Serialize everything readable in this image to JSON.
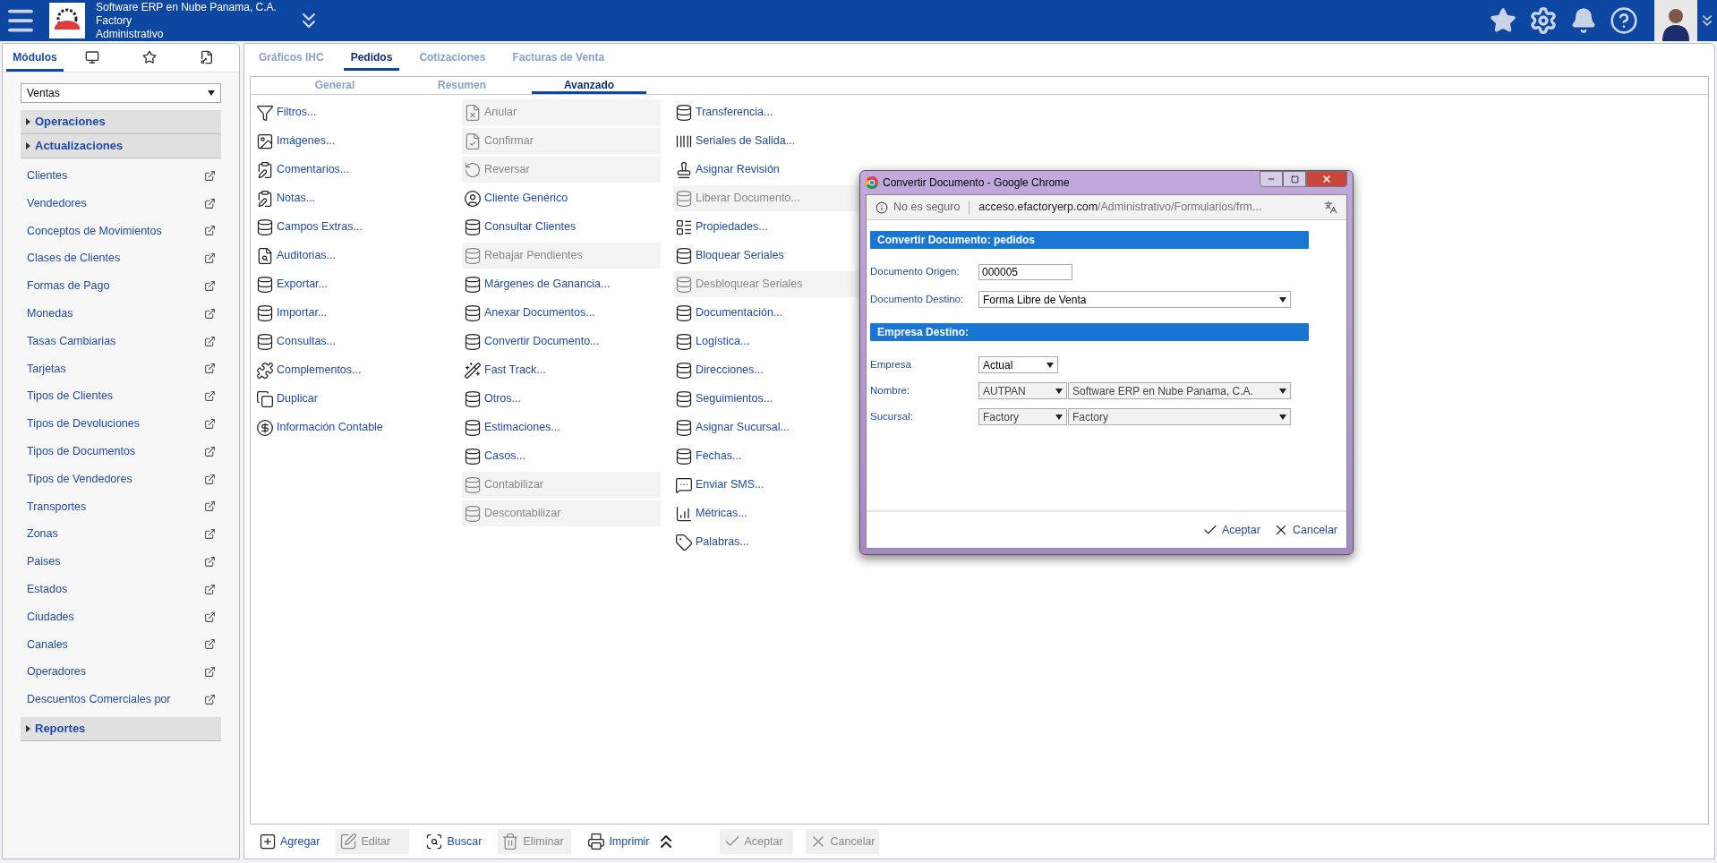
{
  "header": {
    "company": "Software ERP en Nube Panama, C.A.",
    "branch": "Factory",
    "module": "Administrativo"
  },
  "sidebar": {
    "tabs": [
      {
        "label": "Módulos",
        "selected": true
      },
      {
        "selected": false
      },
      {
        "selected": false
      },
      {
        "selected": false
      }
    ],
    "module_select": "Ventas",
    "sections": [
      {
        "title": "Operaciones"
      },
      {
        "title": "Actualizaciones",
        "items": [
          "Clientes",
          "Vendedores",
          "Conceptos de Movimientos",
          "Clases de Clientes",
          "Formas de Pago",
          "Monedas",
          "Tasas Cambiarias",
          "Tarjetas",
          "Tipos de Clientes",
          "Tipos de Devoluciones",
          "Tipos de Documentos",
          "Tipos de Vendedores",
          "Transportes",
          "Zonas",
          "Paises",
          "Estados",
          "Ciudades",
          "Canales",
          "Operadores",
          "Descuentos Comerciales por "
        ]
      },
      {
        "title": "Reportes"
      }
    ]
  },
  "tabs": [
    {
      "label": "Gráficos IHC",
      "selected": false
    },
    {
      "label": "Pedidos",
      "selected": true
    },
    {
      "label": "Cotizaciones",
      "selected": false
    },
    {
      "label": "Facturas de Venta",
      "selected": false
    }
  ],
  "subtabs": [
    {
      "label": "General",
      "selected": false
    },
    {
      "label": "Resumen",
      "selected": false
    },
    {
      "label": "Avanzado",
      "selected": true
    }
  ],
  "actions": [
    [
      {
        "label": "Filtros...",
        "disabled": false
      },
      {
        "label": "Imágenes...",
        "disabled": false
      },
      {
        "label": "Comentarios...",
        "disabled": false
      },
      {
        "label": "Notas...",
        "disabled": false
      },
      {
        "label": "Campos Extras...",
        "disabled": false
      },
      {
        "label": "Auditorias...",
        "disabled": false
      },
      {
        "label": "Exportar...",
        "disabled": false
      },
      {
        "label": "Importar...",
        "disabled": false
      },
      {
        "label": "Consultas...",
        "disabled": false
      },
      {
        "label": "Complementos...",
        "disabled": false
      },
      {
        "label": "Duplicar",
        "disabled": false
      },
      {
        "label": "Información Contable",
        "disabled": false
      }
    ],
    [
      {
        "label": "Anular",
        "disabled": true
      },
      {
        "label": "Confirmar",
        "disabled": true
      },
      {
        "label": "Reversar",
        "disabled": true
      },
      {
        "label": "Cliente Genérico",
        "disabled": false
      },
      {
        "label": "Consultar Clientes",
        "disabled": false
      },
      {
        "label": "Rebajar Pendientes",
        "disabled": true
      },
      {
        "label": "Márgenes de Ganancia...",
        "disabled": false
      },
      {
        "label": "Anexar Documentos...",
        "disabled": false
      },
      {
        "label": "Convertir Documento...",
        "disabled": false
      },
      {
        "label": "Fast Track...",
        "disabled": false
      },
      {
        "label": "Otros...",
        "disabled": false
      },
      {
        "label": "Estimaciones...",
        "disabled": false
      },
      {
        "label": "Casos...",
        "disabled": false
      },
      {
        "label": "Contabilizar",
        "disabled": true
      },
      {
        "label": "Descontabilizar",
        "disabled": true
      }
    ],
    [
      {
        "label": "Transferencia...",
        "disabled": false
      },
      {
        "label": "Seriales de Salida...",
        "disabled": false
      },
      {
        "label": "Asignar Revisión",
        "disabled": false
      },
      {
        "label": "Liberar Documento...",
        "disabled": true
      },
      {
        "label": "Propiedades...",
        "disabled": false
      },
      {
        "label": "Bloquear Seriales",
        "disabled": false
      },
      {
        "label": "Desbloquear Seriales",
        "disabled": true
      },
      {
        "label": "Documentación...",
        "disabled": false
      },
      {
        "label": "Logística...",
        "disabled": false
      },
      {
        "label": "Direcciones...",
        "disabled": false
      },
      {
        "label": "Seguimientos...",
        "disabled": false
      },
      {
        "label": "Asignar Sucursal...",
        "disabled": false
      },
      {
        "label": "Fechas...",
        "disabled": false
      },
      {
        "label": "Enviar SMS...",
        "disabled": false
      },
      {
        "label": "Métricas...",
        "disabled": false
      },
      {
        "label": "Palabras...",
        "disabled": false
      }
    ]
  ],
  "toolbar": [
    {
      "label": "Agregar",
      "disabled": false
    },
    {
      "label": "Editar",
      "disabled": true
    },
    {
      "label": "Buscar",
      "disabled": false
    },
    {
      "label": "Eliminar",
      "disabled": true
    },
    {
      "label": "Imprimir",
      "disabled": false
    },
    {
      "label": "Aceptar",
      "disabled": true
    },
    {
      "label": "Cancelar",
      "disabled": true
    }
  ],
  "dialog": {
    "window_title": "Convertir Documento - Google Chrome",
    "security": "No es seguro",
    "url_host": "acceso.efactoryerp.com",
    "url_path": "/Administrativo/Formularios/frm...",
    "section_1": "Convertir Documento: pedidos",
    "origen": {
      "label": "Documento Origen:",
      "value": "000005"
    },
    "destino": {
      "label": "Documento Destino:",
      "value": "Forma Libre de Venta"
    },
    "section_2": "Empresa Destino:",
    "rows": [
      {
        "label": "Empresa",
        "selects": [
          {
            "value": "Actual",
            "disabled": false
          }
        ]
      },
      {
        "label": "Nombre:",
        "selects": [
          {
            "value": "AUTPAN",
            "disabled": true
          },
          {
            "value": "Software ERP en Nube Panama, C.A.",
            "disabled": true
          }
        ]
      },
      {
        "label": "Sucursal:",
        "selects": [
          {
            "value": "Factory",
            "disabled": true
          },
          {
            "value": "Factory",
            "disabled": true
          }
        ]
      }
    ],
    "buttons": [
      "Aceptar",
      "Cancelar"
    ]
  }
}
